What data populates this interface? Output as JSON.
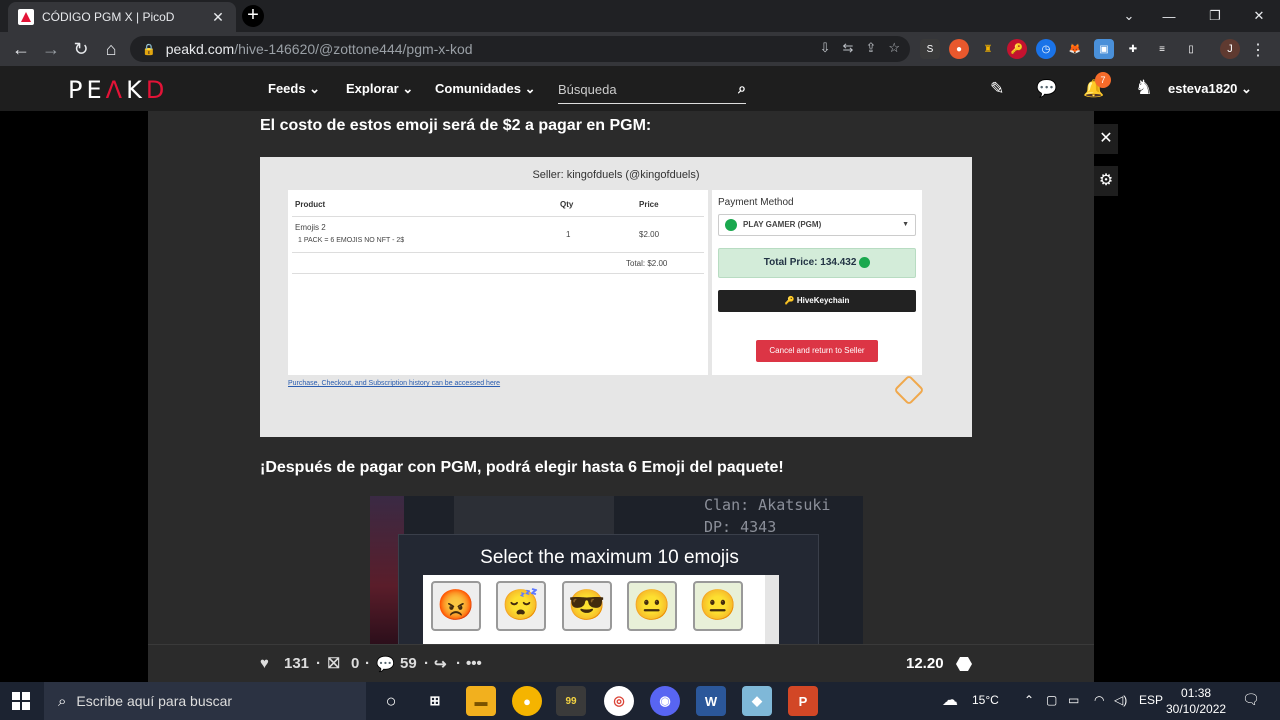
{
  "browser": {
    "tab_title": "CÓDIGO PGM X | PicoD",
    "url_host": "peakd.com",
    "url_path": "/hive-146620/@zottone444/pgm-x-kod",
    "profile_initial": "J"
  },
  "site": {
    "logo_left": "PE",
    "logo_mid": "A",
    "logo_right": "K",
    "logo_end": "D",
    "nav": [
      "Feeds ⌄",
      "Explorar ⌄",
      "Comunidades ⌄"
    ],
    "search_placeholder": "Búsqueda",
    "notification_count": "7",
    "username": "esteva1820 ⌄"
  },
  "post": {
    "paragraph1": "El costo de estos emoji será de $2 a pagar en PGM:",
    "paragraph2": "¡Después de pagar con PGM, podrá elegir hasta 6 Emoji del paquete!"
  },
  "checkout": {
    "seller": "Seller: kingofduels (@kingofduels)",
    "col_product": "Product",
    "col_qty": "Qty",
    "col_price": "Price",
    "item_name": "Emojis 2",
    "item_desc": "1 PACK = 6 EMOJIS NO NFT - 2$",
    "item_qty": "1",
    "item_price": "$2.00",
    "total": "Total: $2.00",
    "history_link": "Purchase, Checkout, and Subscription history can be accessed here",
    "payment_method_title": "Payment Method",
    "payment_method_value": "PLAY GAMER (PGM)",
    "total_price": "Total Price: 134.432",
    "keychain_button": "HiveKeychain",
    "cancel_button": "Cancel and return to Seller"
  },
  "game": {
    "clan": "Clan: Akatsuki",
    "dp": "DP: 4343",
    "modal_title": "Select the maximum 10 emojis",
    "emojis": [
      "😡",
      "😴",
      "😎",
      "😐",
      "😐"
    ]
  },
  "footer": {
    "likes": "131",
    "gifts": "0",
    "comments": "59",
    "payout": "12.20"
  },
  "taskbar": {
    "search_text": "Escribe aquí para buscar",
    "temperature": "15°C",
    "language": "ESP",
    "time": "01:38",
    "date": "30/10/2022"
  }
}
